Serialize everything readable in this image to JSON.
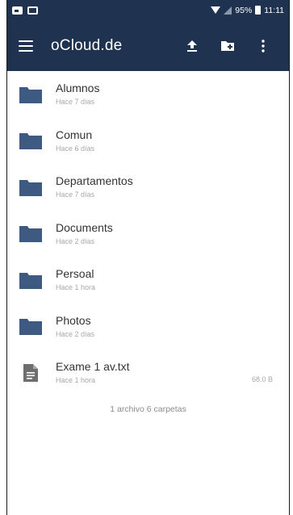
{
  "status_bar": {
    "battery": "95%",
    "time": "11:11"
  },
  "toolbar": {
    "title": "oCloud.de",
    "menu_icon": "hamburger-menu-icon",
    "upload_icon": "upload-icon",
    "new_folder_icon": "new-folder-icon",
    "more_icon": "more-vert-icon"
  },
  "colors": {
    "toolbar": "#1f3350",
    "folder": "#3e5a80",
    "file": "#6e6e6e"
  },
  "items": [
    {
      "name": "Alumnos",
      "date": "Hace 7 días",
      "type": "folder"
    },
    {
      "name": "Comun",
      "date": "Hace 6 días",
      "type": "folder"
    },
    {
      "name": "Departamentos",
      "date": "Hace 7 días",
      "type": "folder"
    },
    {
      "name": "Documents",
      "date": "Hace 2 días",
      "type": "folder"
    },
    {
      "name": "Persoal",
      "date": "Hace 1 hora",
      "type": "folder"
    },
    {
      "name": "Photos",
      "date": "Hace 2 días",
      "type": "folder"
    },
    {
      "name": "Exame 1 av.txt",
      "date": "Hace 1 hora",
      "type": "file",
      "size": "68.0 B"
    }
  ],
  "footer": {
    "summary": "1 archivo 6 carpetas"
  }
}
